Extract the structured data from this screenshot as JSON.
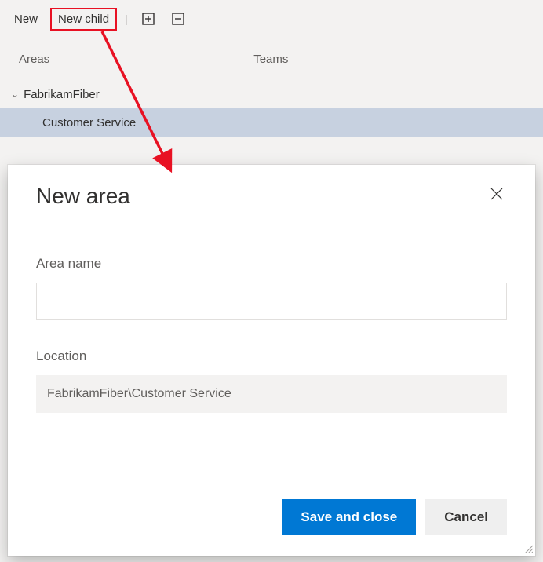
{
  "toolbar": {
    "new_label": "New",
    "new_child_label": "New child"
  },
  "tabs": {
    "areas_label": "Areas",
    "teams_label": "Teams"
  },
  "tree": {
    "parent_label": "FabrikamFiber",
    "child_label": "Customer Service"
  },
  "dialog": {
    "title": "New area",
    "area_name_label": "Area name",
    "area_name_value": "",
    "location_label": "Location",
    "location_value": "FabrikamFiber\\Customer Service",
    "save_label": "Save and close",
    "cancel_label": "Cancel"
  },
  "annotation": {
    "color": "#e81123"
  }
}
